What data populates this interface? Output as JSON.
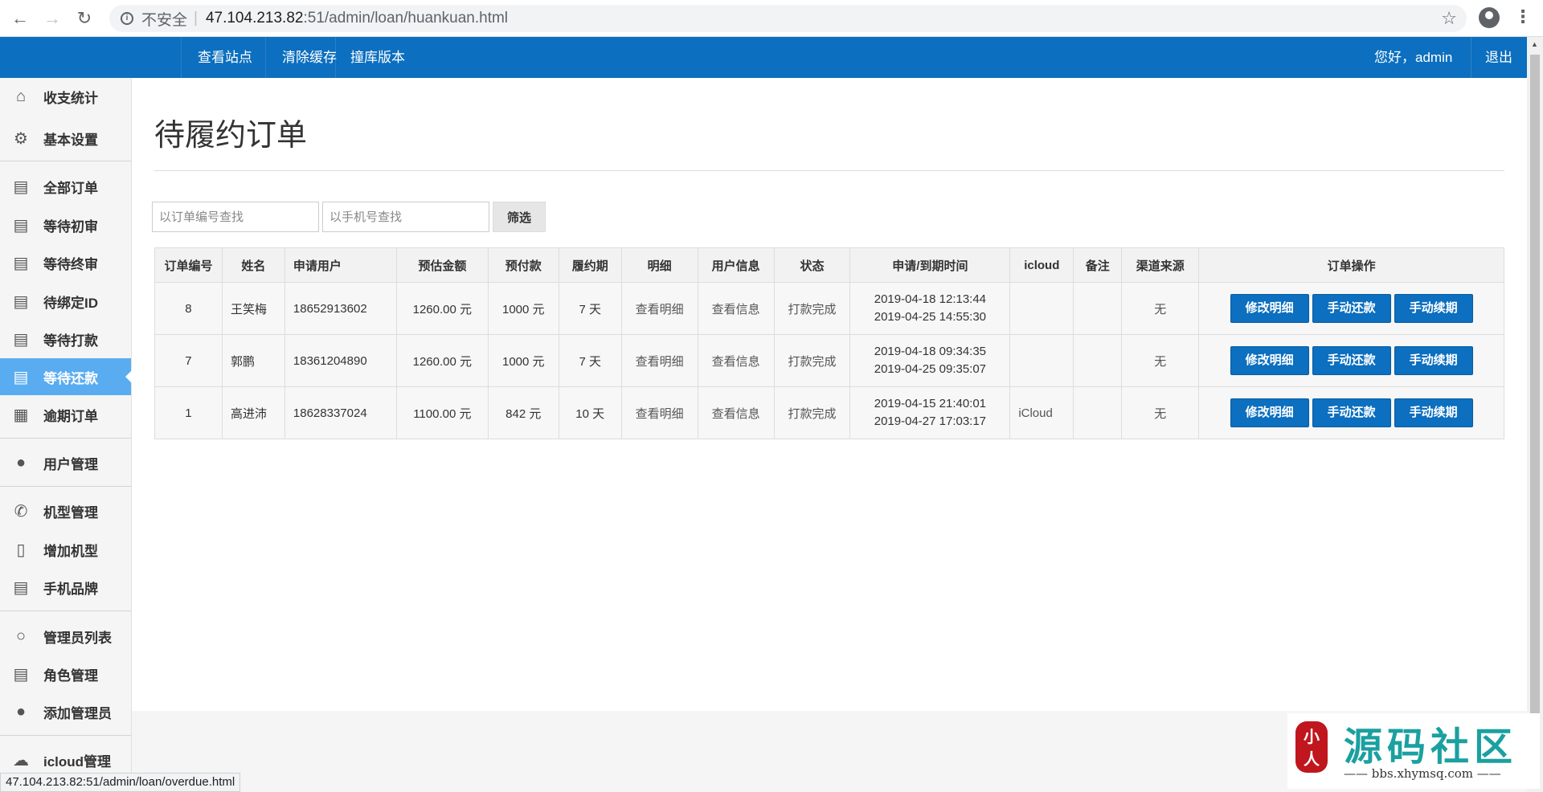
{
  "browser": {
    "insecure_label": "不安全",
    "separator": "|",
    "url_host": "47.104.213.82",
    "url_path": ":51/admin/loan/huankuan.html"
  },
  "topnav": {
    "items": [
      "查看站点",
      "清除缓存",
      "撞库版本"
    ],
    "greeting": "您好，admin",
    "logout": "退出"
  },
  "sidebar": {
    "items": [
      {
        "label": "收支统计",
        "icon": "home-icon"
      },
      {
        "label": "基本设置",
        "icon": "gear-icon"
      },
      {
        "label": "全部订单",
        "icon": "book-icon"
      },
      {
        "label": "等待初审",
        "icon": "book-icon"
      },
      {
        "label": "等待终审",
        "icon": "book-icon"
      },
      {
        "label": "待绑定ID",
        "icon": "book-icon"
      },
      {
        "label": "等待打款",
        "icon": "book-icon"
      },
      {
        "label": "等待还款",
        "icon": "book-icon",
        "active": true
      },
      {
        "label": "逾期订单",
        "icon": "table-icon"
      },
      {
        "label": "用户管理",
        "icon": "user-icon"
      },
      {
        "label": "机型管理",
        "icon": "phone-icon"
      },
      {
        "label": "增加机型",
        "icon": "mobile-icon"
      },
      {
        "label": "手机品牌",
        "icon": "book-icon"
      },
      {
        "label": "管理员列表",
        "icon": "user-outline-icon"
      },
      {
        "label": "角色管理",
        "icon": "card-icon"
      },
      {
        "label": "添加管理员",
        "icon": "user-icon"
      },
      {
        "label": "icloud管理",
        "icon": "cloud-icon"
      }
    ]
  },
  "main": {
    "title": "待履约订单",
    "filter": {
      "order_placeholder": "以订单编号查找",
      "phone_placeholder": "以手机号查找",
      "button": "筛选"
    },
    "table": {
      "headers": [
        "订单编号",
        "姓名",
        "申请用户",
        "预估金额",
        "预付款",
        "履约期",
        "明细",
        "用户信息",
        "状态",
        "申请/到期时间",
        "icloud",
        "备注",
        "渠道来源",
        "订单操作"
      ],
      "rows": [
        {
          "id": "8",
          "name": "王笑梅",
          "phone": "18652913602",
          "amount": "1260.00 元",
          "prepay": "1000 元",
          "period": "7 天",
          "detail": "查看明细",
          "info": "查看信息",
          "status": "打款完成",
          "apply_time": "2019-04-18 12:13:44",
          "due_time": "2019-04-25 14:55:30",
          "icloud": "",
          "note": "",
          "channel": "无"
        },
        {
          "id": "7",
          "name": "郭鹏",
          "phone": "18361204890",
          "amount": "1260.00 元",
          "prepay": "1000 元",
          "period": "7 天",
          "detail": "查看明细",
          "info": "查看信息",
          "status": "打款完成",
          "apply_time": "2019-04-18 09:34:35",
          "due_time": "2019-04-25 09:35:07",
          "icloud": "",
          "note": "",
          "channel": "无"
        },
        {
          "id": "1",
          "name": "高进沛",
          "phone": "18628337024",
          "amount": "1100.00 元",
          "prepay": "842 元",
          "period": "10 天",
          "detail": "查看明细",
          "info": "查看信息",
          "status": "打款完成",
          "apply_time": "2019-04-15 21:40:01",
          "due_time": "2019-04-27 17:03:17",
          "icloud": "iCloud",
          "note": "",
          "channel": "无"
        }
      ],
      "actions": [
        "修改明细",
        "手动还款",
        "手动续期"
      ]
    }
  },
  "status_url": "47.104.213.82:51/admin/loan/overdue.html",
  "watermark": {
    "seal_text": "小人",
    "title": "源码社区",
    "site": "—— bbs.xhymsq.com ——"
  },
  "colors": {
    "nav_blue": "#0c6fbf",
    "active_sidebar": "#5aacf0",
    "watermark_teal": "#1ba0a0"
  }
}
